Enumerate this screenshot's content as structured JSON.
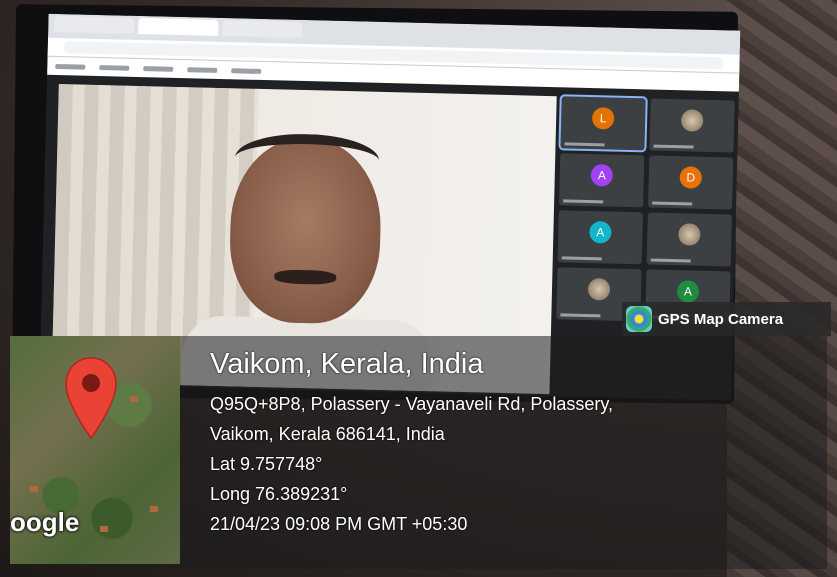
{
  "gps_badge": {
    "label": "GPS Map Camera",
    "icon": "gps-map-camera-icon"
  },
  "map": {
    "provider_logo": "oogle",
    "pin_color": "#ea4335"
  },
  "location": {
    "city": "Vaikom, Kerala, India",
    "address_line1": "Q95Q+8P8, Polassery - Vayanaveli Rd, Polassery,",
    "address_line2": "Vaikom, Kerala 686141, India",
    "lat": "Lat 9.757748°",
    "long": "Long 76.389231°",
    "datetime": "21/04/23 09:08 PM GMT +05:30"
  },
  "meeting": {
    "tiles": [
      {
        "initial": "L",
        "color": "#e37400",
        "highlight": true
      },
      {
        "initial": "",
        "color": "photo"
      },
      {
        "initial": "A",
        "color": "#a142f4"
      },
      {
        "initial": "D",
        "color": "#e8710a"
      },
      {
        "initial": "A",
        "color": "#12b5cb"
      },
      {
        "initial": "",
        "color": "photo"
      },
      {
        "initial": "",
        "color": "photo"
      },
      {
        "initial": "A",
        "color": "#1e8e3e"
      }
    ]
  }
}
